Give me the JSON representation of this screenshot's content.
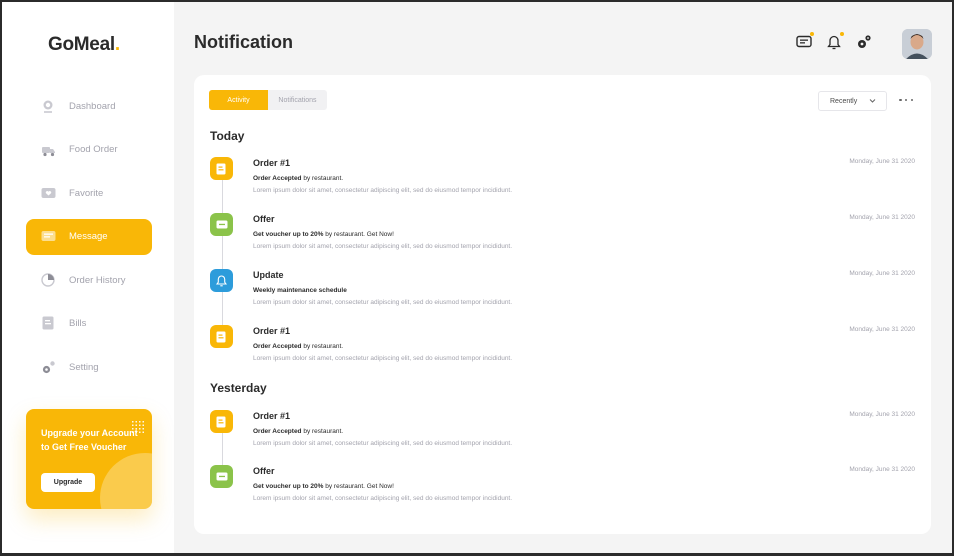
{
  "app": {
    "logo_text": "GoMeal",
    "logo_dot": "."
  },
  "sidebar": {
    "items": [
      {
        "label": "Dashboard",
        "icon": "dashboard-icon",
        "active": false
      },
      {
        "label": "Food Order",
        "icon": "food-order-icon",
        "active": false
      },
      {
        "label": "Favorite",
        "icon": "favorite-icon",
        "active": false
      },
      {
        "label": "Message",
        "icon": "message-icon",
        "active": true
      },
      {
        "label": "Order History",
        "icon": "order-history-icon",
        "active": false
      },
      {
        "label": "Bills",
        "icon": "bills-icon",
        "active": false
      },
      {
        "label": "Setting",
        "icon": "setting-icon",
        "active": false
      }
    ],
    "upgrade": {
      "text": "Upgrade your Account to Get Free Voucher",
      "button_label": "Upgrade"
    }
  },
  "header": {
    "title": "Notification",
    "icons": [
      "message-icon",
      "bell-icon",
      "settings-icon"
    ]
  },
  "toolbar": {
    "tabs": [
      {
        "label": "Activity",
        "active": true
      },
      {
        "label": "Notifications",
        "active": false
      }
    ],
    "sort_label": "Recently"
  },
  "sections": [
    {
      "title": "Today",
      "items": [
        {
          "type": "order",
          "title": "Order #1",
          "sub_bold": "Order Accepted",
          "sub_rest": " by restaurant.",
          "desc": "Lorem ipsum dolor sit amet, consectetur adipiscing elit, sed do eiusmod tempor incididunt.",
          "date": "Monday, June 31 2020"
        },
        {
          "type": "offer",
          "title": "Offer",
          "sub_bold": "Get voucher up to 20%",
          "sub_rest": " by restaurant. Get Now!",
          "desc": "Lorem ipsum dolor sit amet, consectetur adipiscing elit, sed do eiusmod tempor incididunt.",
          "date": "Monday, June 31 2020"
        },
        {
          "type": "update",
          "title": "Update",
          "sub_bold": "Weekly maintenance schedule",
          "sub_rest": "",
          "desc": "Lorem ipsum dolor sit amet, consectetur adipiscing elit, sed do eiusmod tempor incididunt.",
          "date": "Monday, June 31 2020"
        },
        {
          "type": "order",
          "title": "Order #1",
          "sub_bold": "Order Accepted",
          "sub_rest": " by restaurant.",
          "desc": "Lorem ipsum dolor sit amet, consectetur adipiscing elit, sed do eiusmod tempor incididunt.",
          "date": "Monday, June 31 2020"
        }
      ]
    },
    {
      "title": "Yesterday",
      "items": [
        {
          "type": "order",
          "title": "Order #1",
          "sub_bold": "Order Accepted",
          "sub_rest": " by restaurant.",
          "desc": "Lorem ipsum dolor sit amet, consectetur adipiscing elit, sed do eiusmod tempor incididunt.",
          "date": "Monday, June 31 2020"
        },
        {
          "type": "offer",
          "title": "Offer",
          "sub_bold": "Get voucher up to 20%",
          "sub_rest": " by restaurant. Get Now!",
          "desc": "Lorem ipsum dolor sit amet, consectetur adipiscing elit, sed do eiusmod tempor incididunt.",
          "date": "Monday, June 31 2020"
        }
      ]
    }
  ],
  "colors": {
    "accent": "#f9b707",
    "order": "#f9b707",
    "offer": "#8bc34a",
    "update": "#2d9cdb",
    "muted": "#a3a3ad"
  }
}
